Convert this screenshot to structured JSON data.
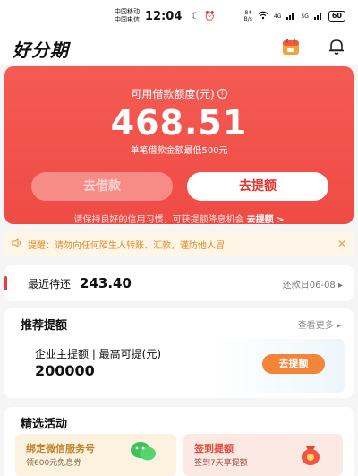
{
  "status_bar": {
    "carrier1": "中国移动",
    "carrier2": "中国电信",
    "time": "12:04",
    "net_speed": "84\nB/s",
    "signal1": "4G",
    "signal2": "5G",
    "battery": "60"
  },
  "header": {
    "logo": "好分期"
  },
  "hero": {
    "title": "可用借款额度(元)",
    "amount": "468.51",
    "subtitle": "单笔借款金额最低500元",
    "borrow_button": "去借款",
    "raise_button": "去提额",
    "tip_text": "请保持良好的信用习惯，可获提额降息机会",
    "tip_link": "去提额 >"
  },
  "notice": {
    "text": "提醒：请勿向任何陌生人转账、汇款，谨防他人冒"
  },
  "repay": {
    "label": "最近待还",
    "amount": "243.40",
    "date": "还款日06-08 ▸"
  },
  "recommend": {
    "title": "推荐提额",
    "more": "查看更多 ▸",
    "card_label": "企业主提额 | 最高可提(元)",
    "card_value": "200000",
    "card_button": "去提额"
  },
  "activities": {
    "title": "精选活动",
    "items": [
      {
        "title": "绑定微信服务号",
        "subtitle": "领600元免息券"
      },
      {
        "title": "签到提额",
        "subtitle": "签到7天享提额"
      }
    ]
  },
  "colors": {
    "brand_red": "#ef4b45",
    "accent_orange": "#f3843a"
  }
}
